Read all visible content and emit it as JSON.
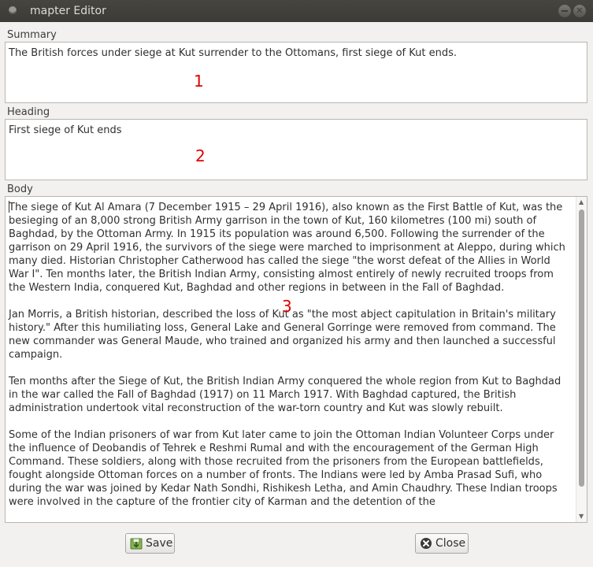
{
  "window": {
    "title": "mapter Editor"
  },
  "summary": {
    "label": "Summary",
    "value": "The British forces under siege at Kut surrender to the Ottomans, first siege of Kut ends.",
    "marker": "1"
  },
  "heading": {
    "label": "Heading",
    "value": "First siege of Kut ends",
    "marker": "2"
  },
  "body": {
    "label": "Body",
    "marker": "3",
    "paragraphs": [
      "The siege of Kut Al Amara (7 December 1915 – 29 April 1916), also known as the First Battle of Kut, was the besieging of an 8,000 strong British Army garrison in the town of Kut, 160 kilometres (100 mi) south of Baghdad, by the Ottoman Army. In 1915 its population was around 6,500. Following the surrender of the garrison on 29 April 1916, the survivors of the siege were marched to imprisonment at Aleppo, during which many died. Historian Christopher Catherwood has called the siege \"the worst defeat of the Allies in World War I\". Ten months later, the British Indian Army, consisting almost entirely of newly recruited troops from the Western India, conquered Kut, Baghdad and other regions in between in the Fall of Baghdad.",
      "Jan Morris, a British historian, described the loss of Kut as \"the most abject capitulation in Britain's military history.\" After this humiliating loss, General Lake and General Gorringe were removed from command. The new commander was General Maude, who trained and organized his army and then launched a successful campaign.",
      "Ten months after the Siege of Kut, the British Indian Army conquered the whole region from Kut to Baghdad in the war called the Fall of Baghdad (1917) on 11 March 1917. With Baghdad captured, the British administration undertook vital reconstruction of the war-torn country and Kut was slowly rebuilt.",
      "Some of the Indian prisoners of war from Kut later came to join the Ottoman Indian Volunteer Corps under the influence of Deobandis of Tehrek e Reshmi Rumal and with the encouragement of the German High Command. These soldiers, along with those recruited from the prisoners from the European battlefields, fought alongside Ottoman forces on a number of fronts. The Indians were led by Amba Prasad Sufi, who during the war was joined by Kedar Nath Sondhi, Rishikesh Letha, and Amin Chaudhry. These Indian troops were involved in the capture of the frontier city of Karman and the detention of the"
    ]
  },
  "buttons": {
    "save": "Save",
    "close": "Close"
  },
  "icons": {
    "save": "save-icon",
    "close": "close-icon",
    "app": "app-icon"
  },
  "colors": {
    "marker": "#e00000",
    "titlebar": "#3c3b37"
  }
}
